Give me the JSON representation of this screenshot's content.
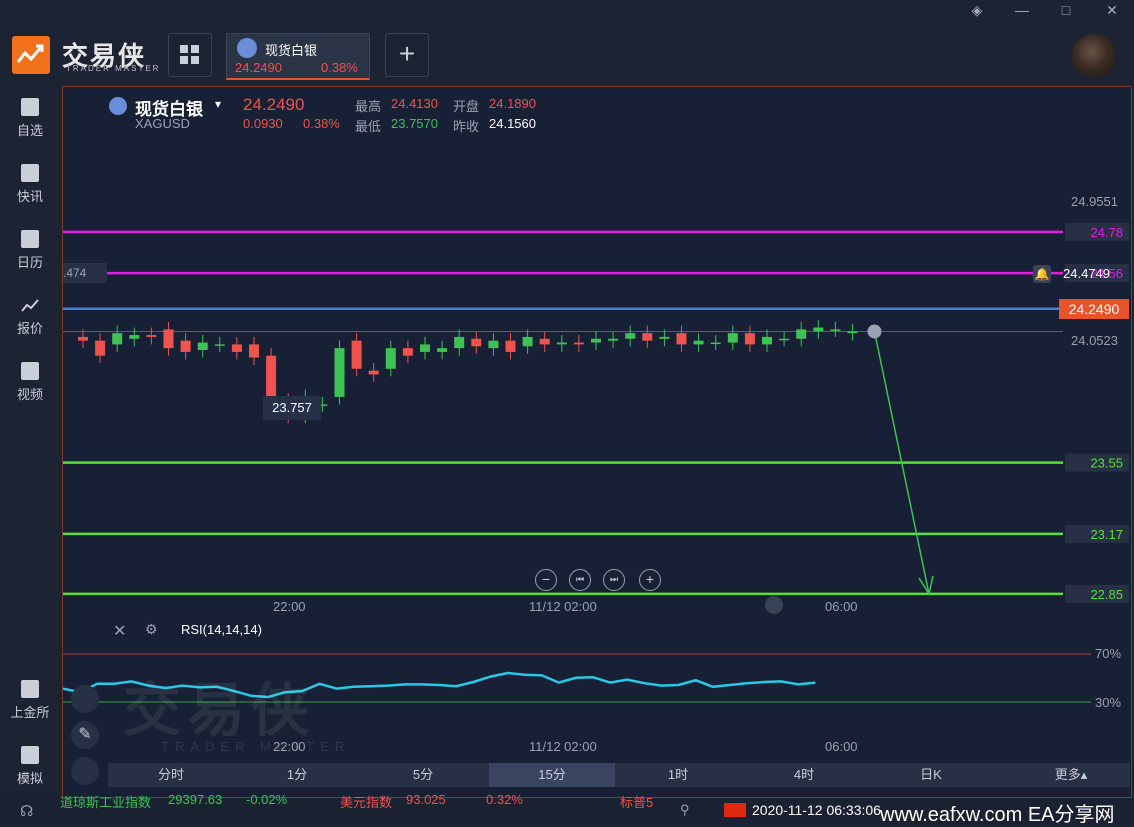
{
  "app": {
    "logo_text": "交易侠",
    "logo_sub": "TRADER MASTER"
  },
  "window_controls": [
    "◈",
    "—",
    "□",
    "✕"
  ],
  "tab": {
    "name": "现货白银",
    "price": "24.2490",
    "change_pct": "0.38%"
  },
  "sidebar": [
    {
      "label": "自选",
      "icon": "bookmark-icon"
    },
    {
      "label": "快讯",
      "icon": "news-icon"
    },
    {
      "label": "日历",
      "icon": "calendar-icon"
    },
    {
      "label": "报价",
      "icon": "quote-chart-icon"
    },
    {
      "label": "视频",
      "icon": "video-icon"
    }
  ],
  "sidebar_bottom": [
    {
      "label": "上金所",
      "icon": "exchange-icon"
    },
    {
      "label": "模拟",
      "icon": "wallet-icon"
    }
  ],
  "instrument": {
    "name": "现货白银",
    "symbol": "XAGUSD",
    "price": "24.2490",
    "change": "0.0930",
    "change_pct": "0.38%",
    "high_label": "最高",
    "high": "24.4130",
    "open_label": "开盘",
    "open": "24.1890",
    "low_label": "最低",
    "low": "23.7570",
    "prev_label": "昨收",
    "prev_close": "24.1560"
  },
  "price_axis": {
    "top": "24.9551",
    "mid_top": "24.4749",
    "current": "24.2490",
    "mid": "24.0523",
    "left_tag": ".474"
  },
  "levels": [
    {
      "value": "24.78",
      "color": "#e81ce0"
    },
    {
      "value": "24.56",
      "color": "#e81ce0"
    },
    {
      "value": "24.37",
      "color": "#4a7be0"
    },
    {
      "value": "23.55",
      "color": "#55e03a"
    },
    {
      "value": "23.17",
      "color": "#55e03a"
    },
    {
      "value": "22.85",
      "color": "#55e03a"
    }
  ],
  "low_marker": "23.757",
  "time_axis": [
    "22:00",
    "11/12 02:00",
    "06:00"
  ],
  "rsi": {
    "label": "RSI(14,14,14)",
    "upper": "70%",
    "lower": "30%"
  },
  "timeframes": [
    "分时",
    "1分",
    "5分",
    "15分",
    "1时",
    "4时",
    "日K",
    "更多▴"
  ],
  "active_timeframe": "15分",
  "status": {
    "ticker1_name": "道琼斯工业指数",
    "ticker1_value": "29397.63",
    "ticker1_change": "-0.02%",
    "ticker2_name": "美元指数",
    "ticker2_value": "93.025",
    "ticker2_change": "0.32%",
    "ticker3_name": "标普5",
    "datetime": "2020-11-12 06:33:06",
    "watermark": "www.eafxw.com  EA分享网"
  },
  "chart_data": {
    "type": "candlestick",
    "symbol": "XAGUSD",
    "ylim": [
      22.6,
      25.1
    ],
    "candles": [
      {
        "o": 24.22,
        "c": 24.2
      },
      {
        "o": 24.2,
        "c": 24.12
      },
      {
        "o": 24.18,
        "c": 24.24
      },
      {
        "o": 24.21,
        "c": 24.23
      },
      {
        "o": 24.23,
        "c": 24.22
      },
      {
        "o": 24.26,
        "c": 24.16
      },
      {
        "o": 24.2,
        "c": 24.14
      },
      {
        "o": 24.15,
        "c": 24.19
      },
      {
        "o": 24.18,
        "c": 24.18
      },
      {
        "o": 24.18,
        "c": 24.14
      },
      {
        "o": 24.18,
        "c": 24.11
      },
      {
        "o": 24.12,
        "c": 23.82
      },
      {
        "o": 23.88,
        "c": 23.8
      },
      {
        "o": 23.8,
        "c": 23.9
      },
      {
        "o": 23.86,
        "c": 23.86
      },
      {
        "o": 23.9,
        "c": 24.16
      },
      {
        "o": 24.2,
        "c": 24.05
      },
      {
        "o": 24.04,
        "c": 24.02
      },
      {
        "o": 24.05,
        "c": 24.16
      },
      {
        "o": 24.16,
        "c": 24.12
      },
      {
        "o": 24.14,
        "c": 24.18
      },
      {
        "o": 24.14,
        "c": 24.16
      },
      {
        "o": 24.16,
        "c": 24.22
      },
      {
        "o": 24.21,
        "c": 24.17
      },
      {
        "o": 24.16,
        "c": 24.2
      },
      {
        "o": 24.2,
        "c": 24.14
      },
      {
        "o": 24.17,
        "c": 24.22
      },
      {
        "o": 24.21,
        "c": 24.18
      },
      {
        "o": 24.18,
        "c": 24.19
      },
      {
        "o": 24.19,
        "c": 24.18
      },
      {
        "o": 24.19,
        "c": 24.21
      },
      {
        "o": 24.2,
        "c": 24.21
      },
      {
        "o": 24.21,
        "c": 24.24
      },
      {
        "o": 24.24,
        "c": 24.2
      },
      {
        "o": 24.21,
        "c": 24.22
      },
      {
        "o": 24.24,
        "c": 24.18
      },
      {
        "o": 24.18,
        "c": 24.2
      },
      {
        "o": 24.19,
        "c": 24.19
      },
      {
        "o": 24.19,
        "c": 24.24
      },
      {
        "o": 24.24,
        "c": 24.18
      },
      {
        "o": 24.18,
        "c": 24.22
      },
      {
        "o": 24.21,
        "c": 24.21
      },
      {
        "o": 24.21,
        "c": 24.26
      },
      {
        "o": 24.25,
        "c": 24.27
      },
      {
        "o": 24.26,
        "c": 24.26
      },
      {
        "o": 24.24,
        "c": 24.25
      }
    ],
    "rsi": [
      44,
      38,
      52,
      52,
      56,
      49,
      45,
      49,
      46,
      47,
      40,
      32,
      30,
      38,
      40,
      52,
      44,
      47,
      48,
      49,
      51,
      51,
      50,
      48,
      55,
      64,
      70,
      67,
      66,
      54,
      62,
      63,
      54,
      59,
      53,
      49,
      50,
      58,
      47,
      50,
      53,
      55,
      56,
      51,
      54
    ]
  }
}
